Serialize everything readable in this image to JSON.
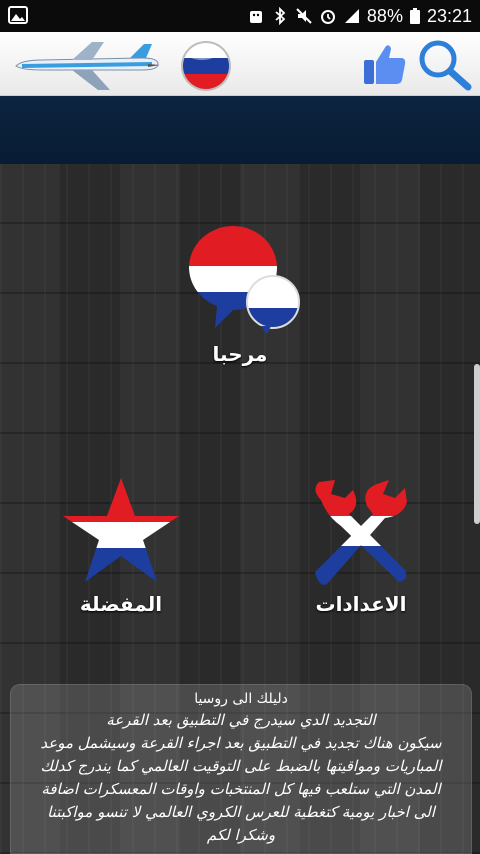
{
  "statusbar": {
    "battery": "88%",
    "time": "23:21"
  },
  "menu": {
    "welcome_label": "مرحبا",
    "favorites_label": "المفضلة",
    "settings_label": "الاعدادات"
  },
  "info": {
    "title": "دليلك الى روسيا",
    "lines": [
      "التجديد الدي سيدرج في التطبيق بعد القرعة",
      "سيكون هناك تجديد في التطبيق بعد اجراء القرعة وسيشمل موعد",
      "المباريات ومواقيتها بالضبط على التوقيت العالمي كما يندرج كدلك",
      "المدن التي ستلعب فيها كل المنتخبات واوقات المعسكرات اضافة",
      "الى اخبار يومية كتغطية للعرس الكروي العالمي لا تنسو مواكبتنا",
      "وشكرا لكم"
    ]
  },
  "colors": {
    "flag_red": "#e11d23",
    "flag_blue": "#1d3e9e",
    "header_dark": "#0c2440"
  }
}
